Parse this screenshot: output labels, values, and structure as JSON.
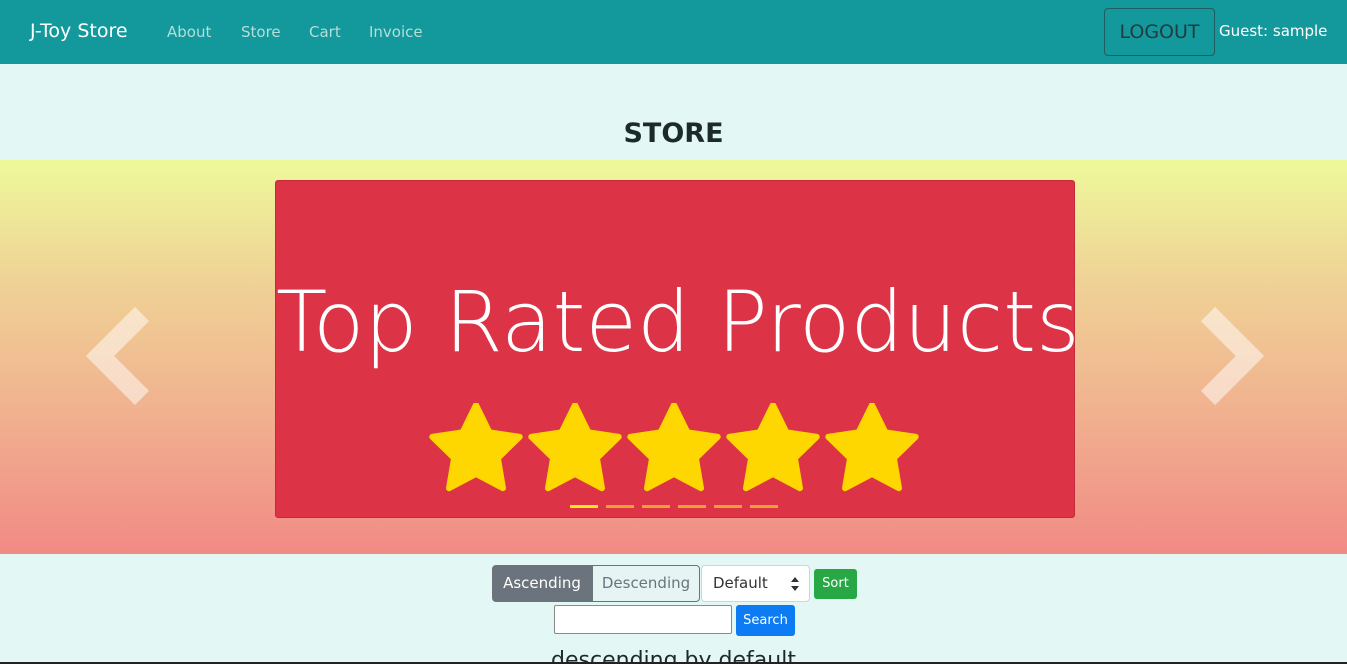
{
  "navbar": {
    "brand": "J-Toy Store",
    "links": [
      "About",
      "Store",
      "Cart",
      "Invoice"
    ],
    "logout_label": "LOGOUT",
    "guest_label": "Guest: sample"
  },
  "page": {
    "title": "STORE"
  },
  "carousel": {
    "slide_title": "Top Rated Products",
    "rating_stars": 5,
    "indicator_count": 6,
    "active_indicator": 1,
    "colors": {
      "slide_bg": "#dc3446",
      "star": "#ffd700",
      "indicator": "#e9a236",
      "indicator_active": "#f4e91b"
    }
  },
  "controls": {
    "ascending_label": "Ascending",
    "descending_label": "Descending",
    "sort_select_value": "Default",
    "sort_button_label": "Sort",
    "search_value": "",
    "search_button_label": "Search"
  },
  "footer_note": "descending by default",
  "colors": {
    "navbar": "#13999c",
    "page_bg": "#e3f7f4"
  },
  "icons": [
    "chevron-left-icon",
    "chevron-right-icon",
    "star-icon",
    "select-caret-icon"
  ]
}
